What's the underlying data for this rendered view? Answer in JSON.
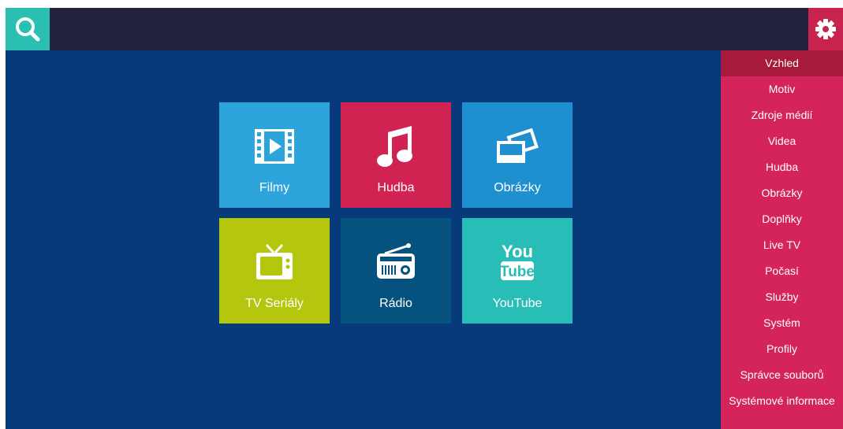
{
  "topbar": {
    "search_icon": "search-icon",
    "settings_icon": "gear-icon"
  },
  "tiles": [
    {
      "label": "Filmy",
      "icon": "film-icon",
      "color": "#2ea4dc"
    },
    {
      "label": "Hudba",
      "icon": "music-note-icon",
      "color": "#d02352"
    },
    {
      "label": "Obrázky",
      "icon": "pictures-icon",
      "color": "#1e8fcf"
    },
    {
      "label": "TV Seriály",
      "icon": "tv-icon",
      "color": "#b4c70e"
    },
    {
      "label": "Rádio",
      "icon": "radio-icon",
      "color": "#06527f"
    },
    {
      "label": "YouTube",
      "icon": "youtube-icon",
      "color": "#29bdb7"
    }
  ],
  "youtube_logo": {
    "line1": "You",
    "line2": "Tube"
  },
  "settings_menu": {
    "items": [
      {
        "label": "Vzhled",
        "active": true
      },
      {
        "label": "Motiv"
      },
      {
        "label": "Zdroje médií"
      },
      {
        "label": "Videa"
      },
      {
        "label": "Hudba"
      },
      {
        "label": "Obrázky"
      },
      {
        "label": "Doplňky"
      },
      {
        "label": "Live TV"
      },
      {
        "label": "Počasí"
      },
      {
        "label": "Služby"
      },
      {
        "label": "Systém"
      },
      {
        "label": "Profily"
      },
      {
        "label": "Správce souborů"
      },
      {
        "label": "Systémové informace"
      }
    ]
  },
  "colors": {
    "background": "#063a7a",
    "topbar": "#22223f",
    "search_button": "#2bbfb1",
    "settings_button": "#c8224f",
    "menu": "#d5245a",
    "menu_active": "#a81a3b"
  }
}
